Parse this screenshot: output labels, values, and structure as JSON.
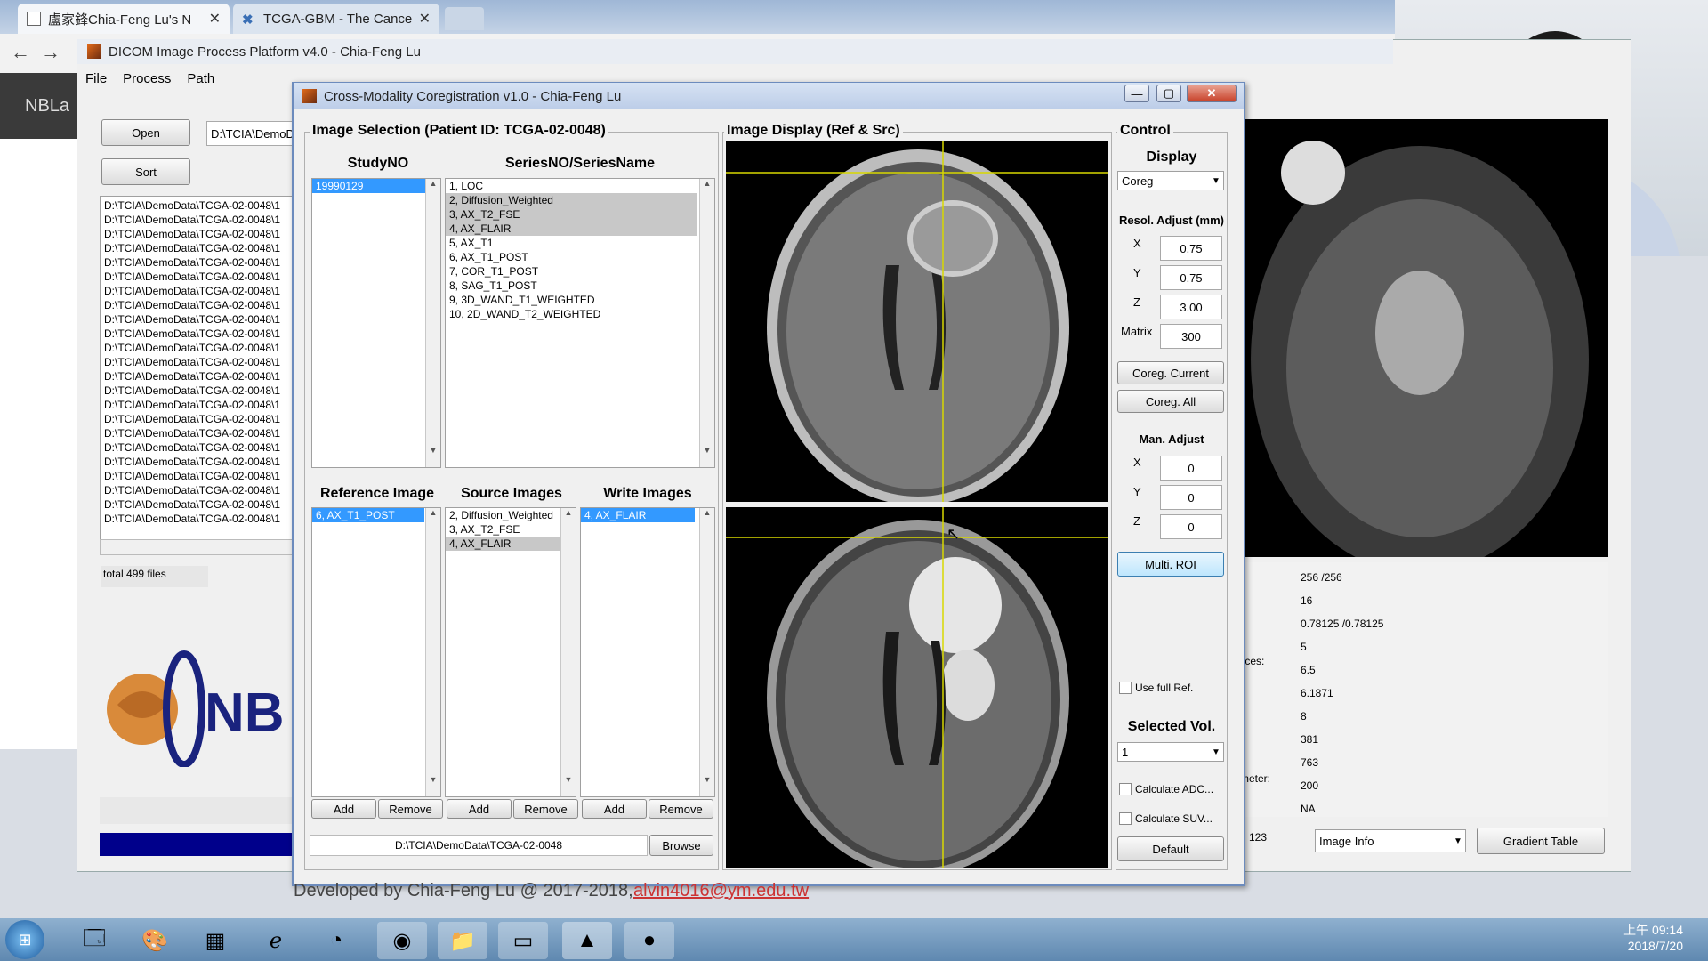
{
  "browser": {
    "tabs": [
      {
        "title": "盧家鋒Chia-Feng Lu's N"
      },
      {
        "title": "TCGA-GBM - The Cance"
      }
    ],
    "back": "←",
    "forward": "→"
  },
  "page": {
    "sidebar_text": "NBLa",
    "footer_text": "Developed by Chia-Feng Lu @ 2017-2018,",
    "footer_email": "alvin4016@ym.edu.tw"
  },
  "dicom": {
    "title": "DICOM Image Process Platform v4.0 - Chia-Feng Lu",
    "menu": [
      "File",
      "Process",
      "Path"
    ],
    "open_label": "Open",
    "sort_label": "Sort",
    "path_value": "D:\\TCIA\\DemoD",
    "file_item": "D:\\TCIA\\DemoData\\TCGA-02-0048\\1",
    "file_count": 23,
    "total": "total 499 files",
    "info_values": [
      "256 /256",
      "16",
      "0.78125 /0.78125",
      "5",
      "6.5",
      "6.1871",
      "8",
      "381",
      "763",
      "200",
      "NA"
    ],
    "info_labels_partial": [
      "lices:",
      "meter:"
    ],
    "image_info_select": "Image Info",
    "gradient_table": "Gradient Table",
    "partial_number": "123"
  },
  "coreg": {
    "title": "Cross-Modality Coregistration v1.0 - Chia-Feng Lu",
    "image_selection": "Image Selection (Patient ID: TCGA-02-0048)",
    "studyno_header": "StudyNO",
    "series_header": "SeriesNO/SeriesName",
    "studies": [
      "19990129"
    ],
    "series": [
      "1, LOC",
      "2, Diffusion_Weighted",
      "3, AX_T2_FSE",
      "4, AX_FLAIR",
      "5, AX_T1",
      "6, AX_T1_POST",
      "7, COR_T1_POST",
      "8, SAG_T1_POST",
      "9, 3D_WAND_T1_WEIGHTED",
      "10, 2D_WAND_T2_WEIGHTED"
    ],
    "ref_header": "Reference Image",
    "src_header": "Source Images",
    "write_header": "Write Images",
    "ref_items": [
      "6, AX_T1_POST"
    ],
    "src_items": [
      "2, Diffusion_Weighted",
      "3, AX_T2_FSE",
      "4, AX_FLAIR"
    ],
    "write_items": [
      "4, AX_FLAIR"
    ],
    "add": "Add",
    "remove": "Remove",
    "path": "D:\\TCIA\\DemoData\\TCGA-02-0048",
    "browse": "Browse",
    "image_display": "Image Display (Ref & Src)",
    "control": "Control",
    "display": "Display",
    "display_value": "Coreg",
    "resol_adjust": "Resol. Adjust (mm)",
    "x": "X",
    "y": "Y",
    "z": "Z",
    "matrix": "Matrix",
    "rx": "0.75",
    "ry": "0.75",
    "rz": "3.00",
    "rmatrix": "300",
    "coreg_current": "Coreg. Current",
    "coreg_all": "Coreg. All",
    "man_adjust": "Man. Adjust",
    "mx": "0",
    "my": "0",
    "mz": "0",
    "multi_roi": "Multi. ROI",
    "use_full_ref": "Use full Ref.",
    "selected_vol": "Selected Vol.",
    "selected_vol_value": "1",
    "calc_adc": "Calculate ADC...",
    "calc_suv": "Calculate SUV...",
    "default": "Default"
  },
  "taskbar": {
    "time": "上午 09:14",
    "date": "2018/7/20"
  }
}
